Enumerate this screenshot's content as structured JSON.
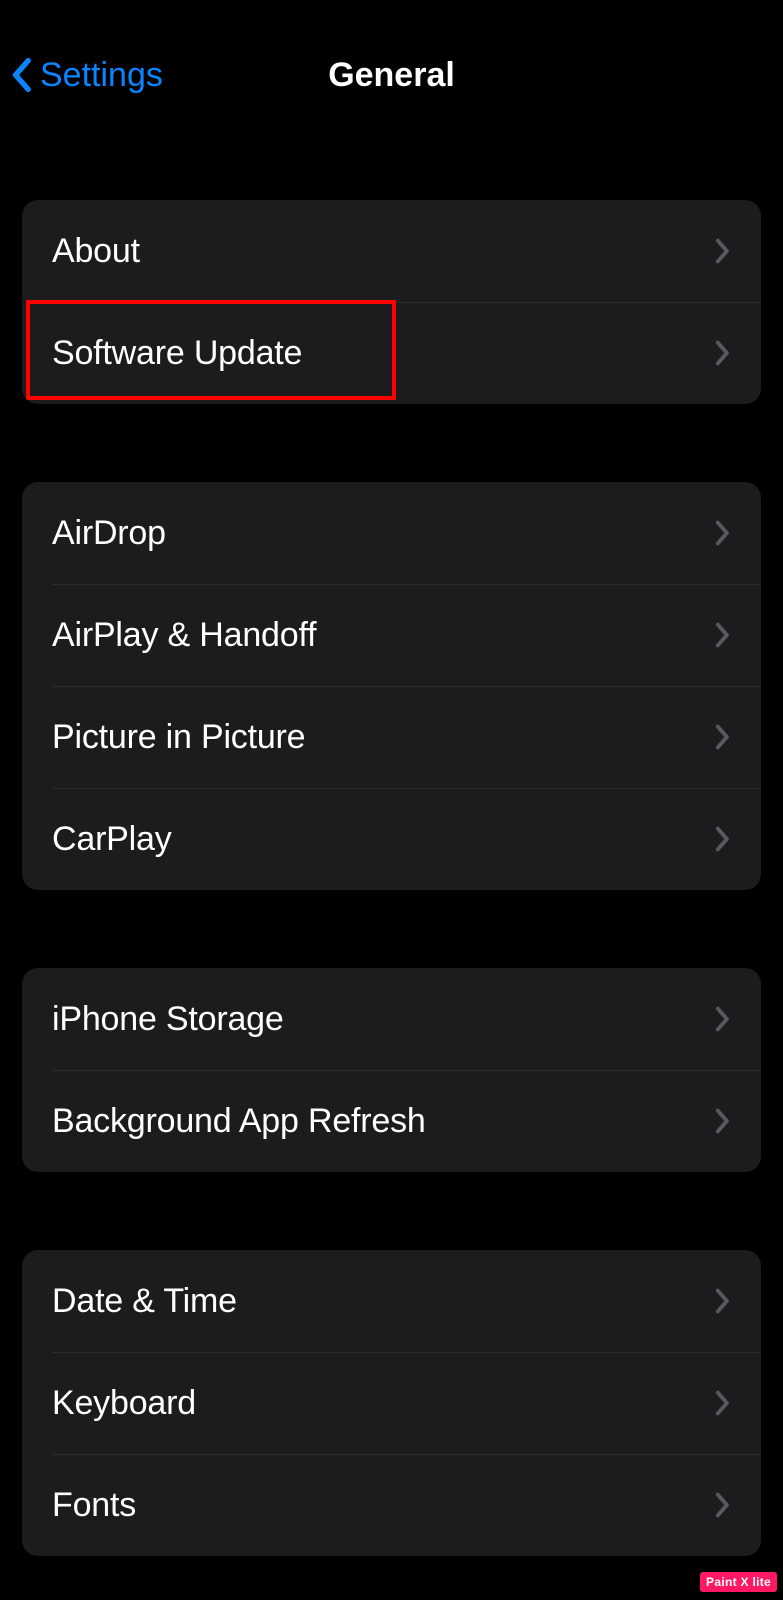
{
  "nav": {
    "back_label": "Settings",
    "title": "General"
  },
  "groups": [
    {
      "rows": [
        {
          "id": "about",
          "label": "About"
        },
        {
          "id": "software-update",
          "label": "Software Update",
          "highlighted": true
        }
      ]
    },
    {
      "rows": [
        {
          "id": "airdrop",
          "label": "AirDrop"
        },
        {
          "id": "airplay-handoff",
          "label": "AirPlay & Handoff"
        },
        {
          "id": "picture-in-picture",
          "label": "Picture in Picture"
        },
        {
          "id": "carplay",
          "label": "CarPlay"
        }
      ]
    },
    {
      "rows": [
        {
          "id": "iphone-storage",
          "label": "iPhone Storage"
        },
        {
          "id": "background-app-refresh",
          "label": "Background App Refresh"
        }
      ]
    },
    {
      "rows": [
        {
          "id": "date-time",
          "label": "Date & Time"
        },
        {
          "id": "keyboard",
          "label": "Keyboard"
        },
        {
          "id": "fonts",
          "label": "Fonts"
        }
      ]
    }
  ],
  "annotation": {
    "highlight_color": "#FF0000",
    "highlight_target": "software-update"
  },
  "watermark": {
    "text": "Paint X lite"
  }
}
